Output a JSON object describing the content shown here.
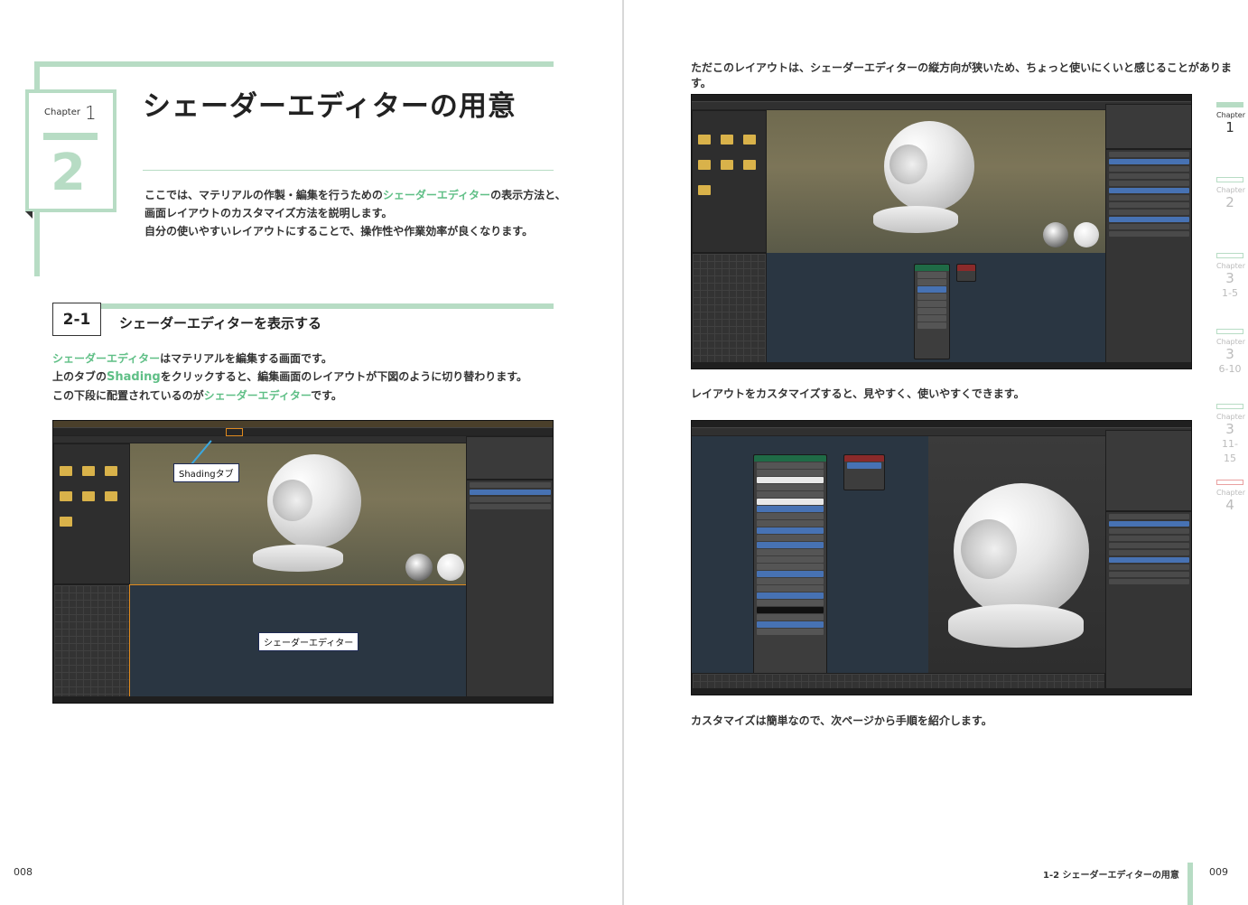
{
  "left": {
    "chapter_label": "Chapter",
    "chapter_number": "1",
    "section_number": "2",
    "title": "シェーダーエディターの用意",
    "intro": {
      "line1_pre": "ここでは、マテリアルの作製・編集を行うための",
      "line1_hl": "シェーダーエディター",
      "line1_post": "の表示方法と、",
      "line2": "画面レイアウトのカスタマイズ方法を説明します。",
      "line3": "自分の使いやすいレイアウトにすることで、操作性や作業効率が良くなります。"
    },
    "section": {
      "number": "2-1",
      "title": "シェーダーエディターを表示する"
    },
    "body": {
      "l1_hl": "シェーダーエディター",
      "l1_post": "はマテリアルを編集する画面です。",
      "l2_pre": "上のタブの",
      "l2_hl": "Shading",
      "l2_post": "をクリックすると、編集画面のレイアウトが下図のように切り替わります。",
      "l3_pre": "この下段に配置されているのが",
      "l3_hl": "シェーダーエディター",
      "l3_post": "です。"
    },
    "callouts": {
      "shading_tab": "Shadingタブ",
      "shader_editor": "シェーダーエディター"
    },
    "page_number": "008"
  },
  "right": {
    "text1": "ただこのレイアウトは、シェーダーエディターの縦方向が狭いため、ちょっと使いにくいと感じることがあります。",
    "text2": "レイアウトをカスタマイズすると、見やすく、使いやすくできます。",
    "text3": "カスタマイズは簡単なので、次ページから手順を紹介します。",
    "running_head": "1-2 シェーダーエディターの用意",
    "page_number": "009"
  },
  "side_index": [
    {
      "label": "Chapter",
      "num": "1",
      "sub": "",
      "active": true
    },
    {
      "label": "Chapter",
      "num": "2",
      "sub": "",
      "active": false
    },
    {
      "label": "Chapter",
      "num": "3",
      "sub": "1-5",
      "active": false
    },
    {
      "label": "Chapter",
      "num": "3",
      "sub": "6-10",
      "active": false
    },
    {
      "label": "Chapter",
      "num": "3",
      "sub": "11-15",
      "active": false
    },
    {
      "label": "Chapter",
      "num": "4",
      "sub": "",
      "active": false
    }
  ],
  "colors": {
    "accent_green": "#5fbf86",
    "deco_green": "#b7dcc4",
    "highlight_orange": "#e08a1e",
    "callout_line_blue": "#3aa7e0"
  }
}
